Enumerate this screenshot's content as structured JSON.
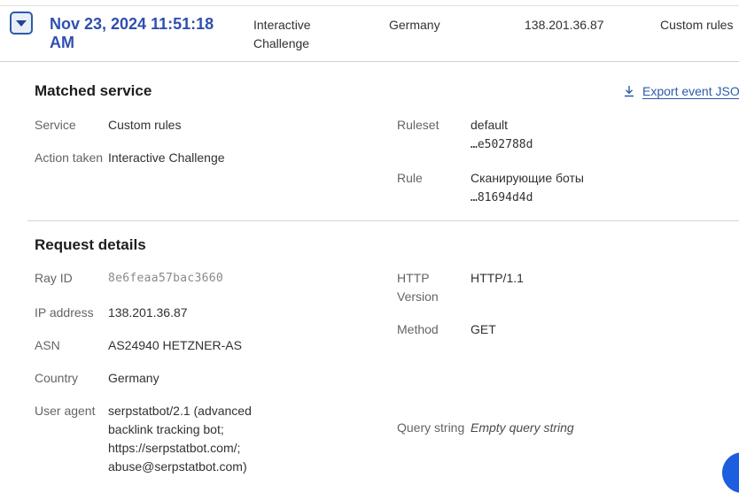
{
  "event_row": {
    "timestamp": "Nov 23, 2024 11:51:18 AM",
    "action": "Interactive Challenge",
    "country": "Germany",
    "ip": "138.201.36.87",
    "service": "Custom rules"
  },
  "matched_service": {
    "title": "Matched service",
    "export_label": "Export event JSON",
    "service_label": "Service",
    "service_value": "Custom rules",
    "action_label": "Action taken",
    "action_value": "Interactive Challenge",
    "ruleset_label": "Ruleset",
    "ruleset_name": "default",
    "ruleset_id": "…e502788d",
    "rule_label": "Rule",
    "rule_name": "Сканирующие боты",
    "rule_id": "…81694d4d"
  },
  "request_details": {
    "title": "Request details",
    "ray_label": "Ray ID",
    "ray_value": "8e6feaa57bac3660",
    "ip_label": "IP address",
    "ip_value": "138.201.36.87",
    "asn_label": "ASN",
    "asn_value": "AS24940 HETZNER-AS",
    "country_label": "Country",
    "country_value": "Germany",
    "ua_label": "User agent",
    "ua_lines": [
      "serpstatbot/2.1 (advanced",
      "backlink tracking bot;",
      "https://serpstatbot.com/;",
      "abuse@serpstatbot.com)"
    ],
    "http_label_lines": [
      "HTTP",
      "Version"
    ],
    "http_value": "HTTP/1.1",
    "method_label": "Method",
    "method_value": "GET",
    "query_label": "Query string",
    "query_value": "Empty query string"
  },
  "colors": {
    "accent": "#2c5ba8",
    "timestamp": "#2f4fb0",
    "fab": "#1d5ee0"
  }
}
